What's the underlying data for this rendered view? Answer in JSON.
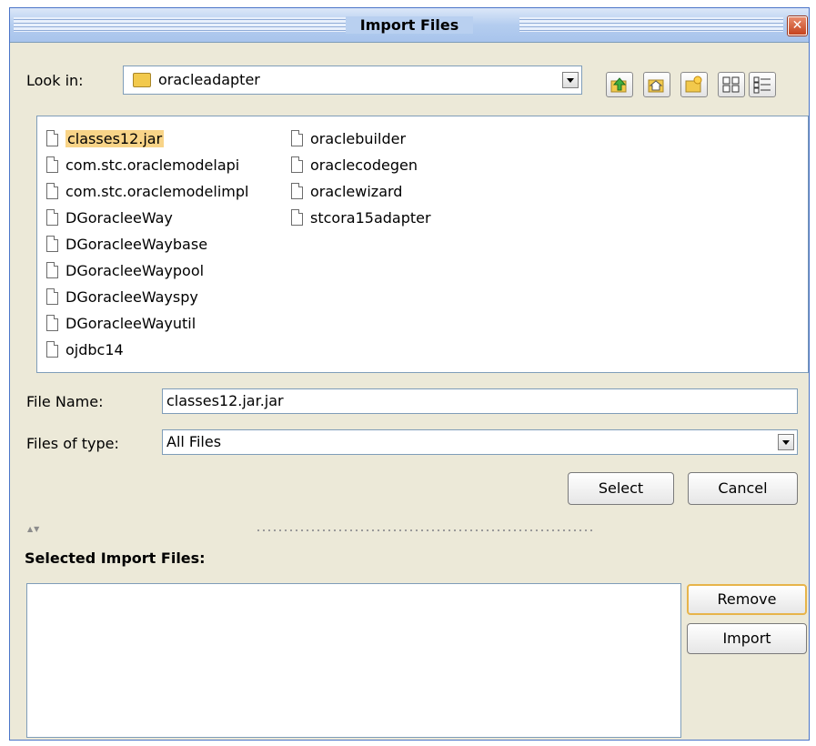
{
  "window": {
    "title": "Import Files",
    "close_symbol": "✕"
  },
  "look_in": {
    "label": "Look in:",
    "value": "oracleadapter"
  },
  "toolbar": {
    "icons": [
      "up-one-level-icon",
      "home-icon",
      "new-folder-icon",
      "list-view-icon",
      "details-view-icon"
    ]
  },
  "files": [
    {
      "name": "classes12.jar",
      "selected": true
    },
    {
      "name": "com.stc.oraclemodelapi"
    },
    {
      "name": "com.stc.oraclemodelimpl"
    },
    {
      "name": "DGoracleeWay"
    },
    {
      "name": "DGoracleeWaybase"
    },
    {
      "name": "DGoracleeWaypool"
    },
    {
      "name": "DGoracleeWayspy"
    },
    {
      "name": "DGoracleeWayutil"
    },
    {
      "name": "ojdbc14"
    },
    {
      "name": "oraclebuilder"
    },
    {
      "name": "oraclecodegen"
    },
    {
      "name": "oraclewizard"
    },
    {
      "name": "stcora15adapter"
    }
  ],
  "file_name": {
    "label": "File Name:",
    "value": "classes12.jar.jar"
  },
  "files_of_type": {
    "label": "Files of type:",
    "value": "All Files"
  },
  "buttons": {
    "select": "Select",
    "cancel": "Cancel",
    "remove": "Remove",
    "import": "Import"
  },
  "selected_section": {
    "title": "Selected Import Files:"
  },
  "colors": {
    "selection": "#f8d488",
    "dialog_bg": "#ece9d8",
    "title_bar": "#b4cdef",
    "focus_border": "#e7b44a"
  }
}
